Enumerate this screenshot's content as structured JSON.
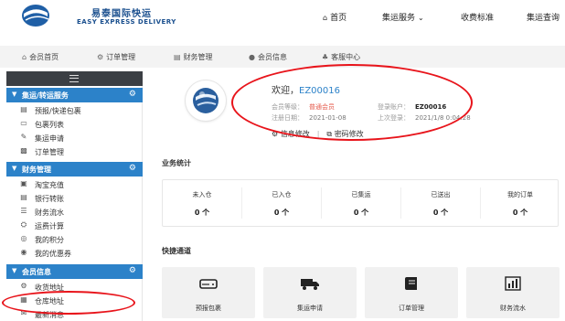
{
  "brand": {
    "name_cn": "易泰国际快运",
    "name_en": "EASY EXPRESS DELIVERY"
  },
  "topnav": {
    "home": "首页",
    "services": "集运服务",
    "pricing": "收费标准",
    "tracking": "集运查询"
  },
  "subnav": [
    {
      "label": "会员首页",
      "icon": "home-icon"
    },
    {
      "label": "订单管理",
      "icon": "settings-icon"
    },
    {
      "label": "财务管理",
      "icon": "credit-card-icon"
    },
    {
      "label": "会员信息",
      "icon": "user-icon"
    },
    {
      "label": "客服中心",
      "icon": "headset-icon"
    }
  ],
  "sidebar": {
    "groups": [
      {
        "title": "集运/转运服务",
        "items": [
          {
            "label": "预报/快递包裹",
            "icon": "box-icon"
          },
          {
            "label": "包裹列表",
            "icon": "inbox-icon"
          },
          {
            "label": "集运申请",
            "icon": "edit-icon"
          },
          {
            "label": "订单管理",
            "icon": "document-icon"
          }
        ]
      },
      {
        "title": "财务管理",
        "items": [
          {
            "label": "淘宝充值",
            "icon": "shopping-icon"
          },
          {
            "label": "银行转账",
            "icon": "bank-icon"
          },
          {
            "label": "财务流水",
            "icon": "list-icon"
          },
          {
            "label": "运费计算",
            "icon": "calculator-icon"
          },
          {
            "label": "我的积分",
            "icon": "points-icon"
          },
          {
            "label": "我的优惠券",
            "icon": "coupon-icon"
          }
        ]
      },
      {
        "title": "会员信息",
        "items": [
          {
            "label": "收货地址",
            "icon": "location-icon"
          },
          {
            "label": "仓库地址",
            "icon": "warehouse-icon"
          },
          {
            "label": "最新消息",
            "icon": "mail-icon"
          }
        ]
      }
    ]
  },
  "profile": {
    "welcome_prefix": "欢迎，",
    "member_code": "EZ00016",
    "level_label": "会员等级：",
    "level_value": "普通会员",
    "account_label": "登录账户：",
    "account_value": "EZ00016",
    "register_label": "注册日期：",
    "register_value": "2021-01-08",
    "last_login_label": "上次登录：",
    "last_login_value": "2021/1/8 0:04:28",
    "edit_info": "信息修改",
    "sep": "|",
    "edit_password": "密码修改"
  },
  "stats": {
    "title": "业务统计",
    "items": [
      {
        "label": "未入仓",
        "value": "0 个"
      },
      {
        "label": "已入仓",
        "value": "0 个"
      },
      {
        "label": "已集运",
        "value": "0 个"
      },
      {
        "label": "已送出",
        "value": "0 个"
      },
      {
        "label": "我的订单",
        "value": "0 个"
      }
    ]
  },
  "quick": {
    "title": "快捷通道",
    "items": [
      {
        "label": "预报包裹",
        "icon": "drive-icon"
      },
      {
        "label": "集运申请",
        "icon": "truck-icon"
      },
      {
        "label": "订单管理",
        "icon": "book-icon"
      },
      {
        "label": "财务流水",
        "icon": "bar-chart-icon"
      }
    ]
  },
  "annotation_color": "#e8141b",
  "accent_color": "#2c82c9"
}
